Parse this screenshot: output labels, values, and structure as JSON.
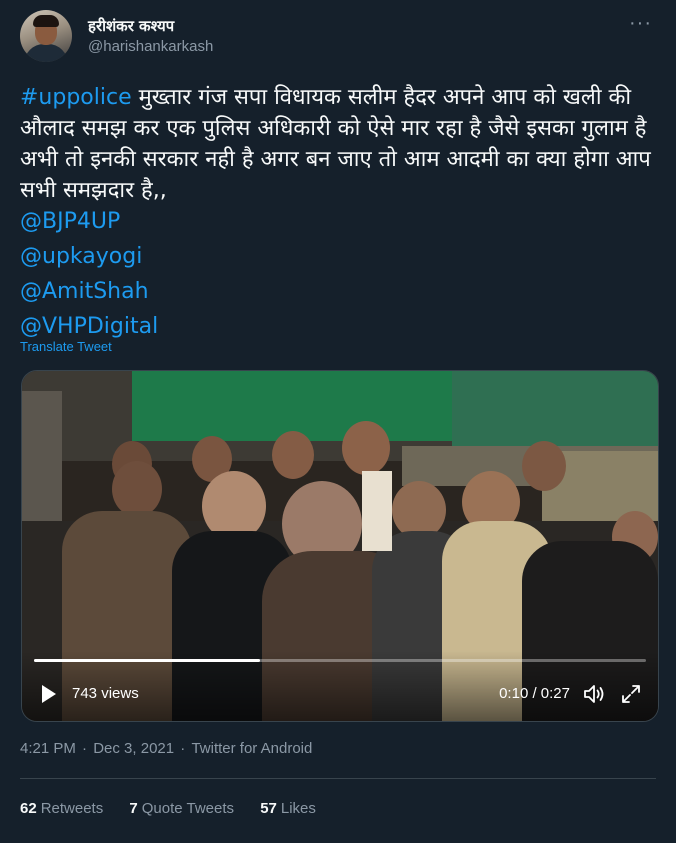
{
  "author": {
    "display_name": "हरीशंकर कश्यप",
    "handle": "@harishankarkash",
    "more_icon": "more-icon"
  },
  "tweet": {
    "hashtag": "#uppolice",
    "text": " मुख्तार गंज सपा विधायक सलीम हैदर अपने आप को खली की औलाद समझ कर एक पुलिस अधिकारी को ऐसे मार रहा है जैसे इसका गुलाम है अभी तो इनकी सरकार नही है अगर बन जाए तो आम आदमी का क्या होगा आप सभी समझदार है,,",
    "mentions": [
      "@BJP4UP",
      "@upkayogi",
      "@AmitShah",
      "@VHPDigital"
    ],
    "translate_label": "Translate Tweet"
  },
  "video": {
    "views": "743 views",
    "time": "0:10 / 0:27",
    "progress": 0.37,
    "play_icon": "play-icon",
    "volume_icon": "volume-icon",
    "fullscreen_icon": "fullscreen-icon"
  },
  "meta": {
    "time": "4:21 PM",
    "date": "Dec 3, 2021",
    "source": "Twitter for Android",
    "separator": " · "
  },
  "stats": {
    "retweets_count": "62",
    "retweets_label": "Retweets",
    "quotes_count": "7",
    "quotes_label": "Quote Tweets",
    "likes_count": "57",
    "likes_label": "Likes"
  },
  "colors": {
    "background": "#15202b",
    "link": "#1d9bf0",
    "secondary_text": "#8b98a5",
    "border": "#38444d"
  }
}
